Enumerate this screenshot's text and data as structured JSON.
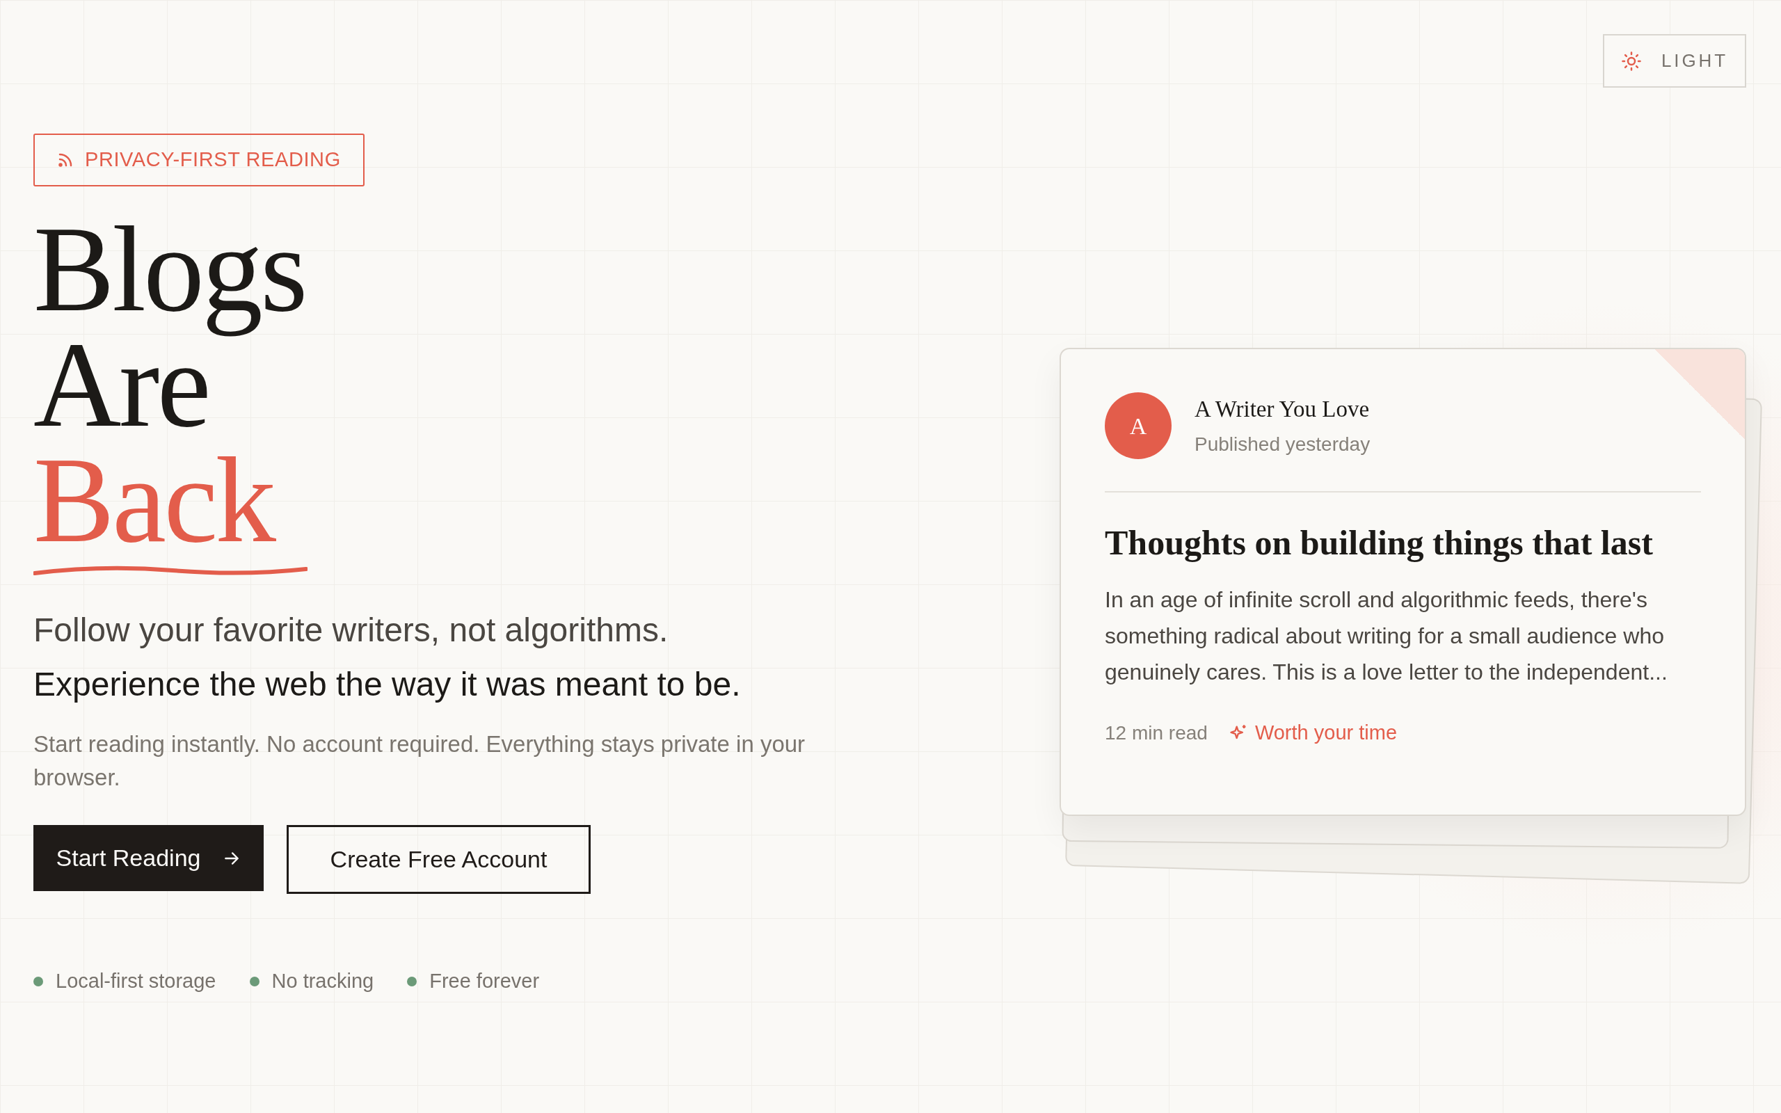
{
  "theme_toggle": {
    "label": "LIGHT"
  },
  "badge": {
    "label": "PRIVACY-FIRST READING"
  },
  "headline": [
    {
      "text": "Blogs",
      "accent": false
    },
    {
      "text": "Are",
      "accent": false
    },
    {
      "text": "Back",
      "accent": true
    }
  ],
  "tagline": [
    "Follow your favorite writers, not algorithms.",
    "Experience the web the way it was meant to be."
  ],
  "description": "Start reading instantly. No account required. Everything stays private in your browser.",
  "buttons": [
    {
      "label": "Start Reading",
      "kind": "primary"
    },
    {
      "label": "Create Free Account",
      "kind": "outline"
    }
  ],
  "features": [
    {
      "label": "Local-first storage",
      "color": "#6b9a78"
    },
    {
      "label": "No tracking",
      "color": "#6b9a78"
    },
    {
      "label": "Free forever",
      "color": "#6b9a78"
    }
  ],
  "preview_card": {
    "avatar": "A",
    "author": "A Writer You Love",
    "published": "Published yesterday",
    "title": "Thoughts on building things that last",
    "excerpt": "In an age of infinite scroll and algorithmic feeds, there's something radical about writing for a small audience who genuinely cares. This is a love letter to the independent...",
    "read_time": "12 min read",
    "tag": "Worth your time"
  }
}
